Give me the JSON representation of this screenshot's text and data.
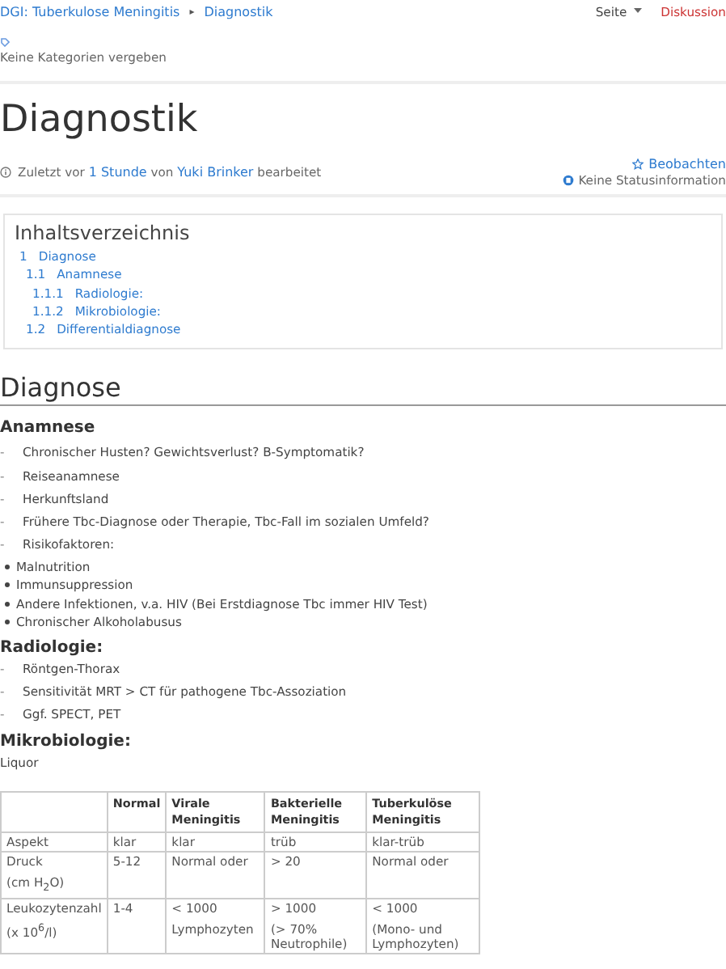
{
  "breadcrumb": {
    "items": [
      {
        "label": "DGI:  Tuberkulose Meningitis"
      },
      {
        "label": "Diagnostik"
      }
    ],
    "separator": "▸"
  },
  "top_actions": [
    {
      "label": "Seite",
      "kind": "menu"
    },
    {
      "label": "Diskussion",
      "kind": "link"
    }
  ],
  "categories": {
    "text": "Keine Kategorien vergeben"
  },
  "title": "Diagnostik",
  "meta": {
    "prefix": "Zuletzt vor",
    "time": "1 Stunde",
    "middle": "von",
    "author": "Yuki Brinker",
    "suffix": "bearbeitet",
    "watch": "Beobachten",
    "status": "Keine Statusinformation"
  },
  "toc": {
    "title": "Inhaltsverzeichnis",
    "items": [
      {
        "number": "1",
        "label": "Diagnose",
        "children": [
          {
            "number": "1.1",
            "label": "Anamnese",
            "children": [
              {
                "number": "1.1.1",
                "label": "Radiologie:"
              },
              {
                "number": "1.1.2",
                "label": "Mikrobiologie:"
              }
            ]
          },
          {
            "number": "1.2",
            "label": "Differentialdiagnose"
          }
        ]
      }
    ]
  },
  "section": "Diagnose",
  "subsections": [
    {
      "title": "Anamnese",
      "items": [
        {
          "kind": "dash",
          "marker": "-",
          "text": "Chronischer Husten? Gewichtsverlust? B-Symptomatik?"
        },
        {
          "kind": "dash",
          "marker": "-",
          "text": "Reiseanamnese"
        },
        {
          "kind": "dash",
          "marker": "-",
          "text": "Herkunftsland"
        },
        {
          "kind": "dash",
          "marker": "-",
          "text": "Frühere Tbc-Diagnose oder Therapie, Tbc-Fall im sozialen Umfeld?"
        },
        {
          "kind": "dash",
          "marker": "-",
          "text": "Risikofaktoren:"
        },
        {
          "kind": "bullet",
          "text": "Malnutrition"
        },
        {
          "kind": "bullet",
          "text": "Immunsuppression"
        },
        {
          "kind": "bullet",
          "text": "Andere Infektionen, v.a. HIV (Bei Erstdiagnose Tbc immer HIV Test)"
        },
        {
          "kind": "bullet",
          "text": "Chronischer Alkoholabusus"
        }
      ]
    },
    {
      "title": "Radiologie:",
      "items": [
        {
          "kind": "dash",
          "marker": "-",
          "text": "Röntgen-Thorax"
        },
        {
          "kind": "dash",
          "marker": "-",
          "text": "Sensitivität MRT > CT für pathogene Tbc-Assoziation"
        },
        {
          "kind": "dash",
          "marker": "-",
          "text": "Ggf. SPECT, PET"
        }
      ]
    },
    {
      "title": "Mikrobiologie:",
      "items": [
        {
          "kind": "plain",
          "text": "Liquor"
        }
      ]
    }
  ],
  "table": {
    "columns": [
      "",
      "Normal",
      "Virale Meningitis",
      "Bakterielle Meningitis",
      "Tuberkulöse Meningitis"
    ],
    "rows": [
      [
        [
          "Aspekt"
        ],
        [
          "klar"
        ],
        [
          "klar"
        ],
        [
          "trüb"
        ],
        [
          "klar-trüb"
        ]
      ],
      [
        [
          "Druck",
          "(cm H$_{2}$O)"
        ],
        [
          "5-12"
        ],
        [
          "Normal oder"
        ],
        [
          "> 20"
        ],
        [
          "Normal oder"
        ]
      ],
      [
        [
          "Leukozytenzahl",
          "(x 10$^{6}$/l)"
        ],
        [
          "1-4"
        ],
        [
          "< 1000",
          "Lymphozyten"
        ],
        [
          "> 1000",
          "(> 70% Neutrophile)"
        ],
        [
          "< 1000",
          "(Mono- und Lymphozyten)"
        ]
      ]
    ]
  }
}
